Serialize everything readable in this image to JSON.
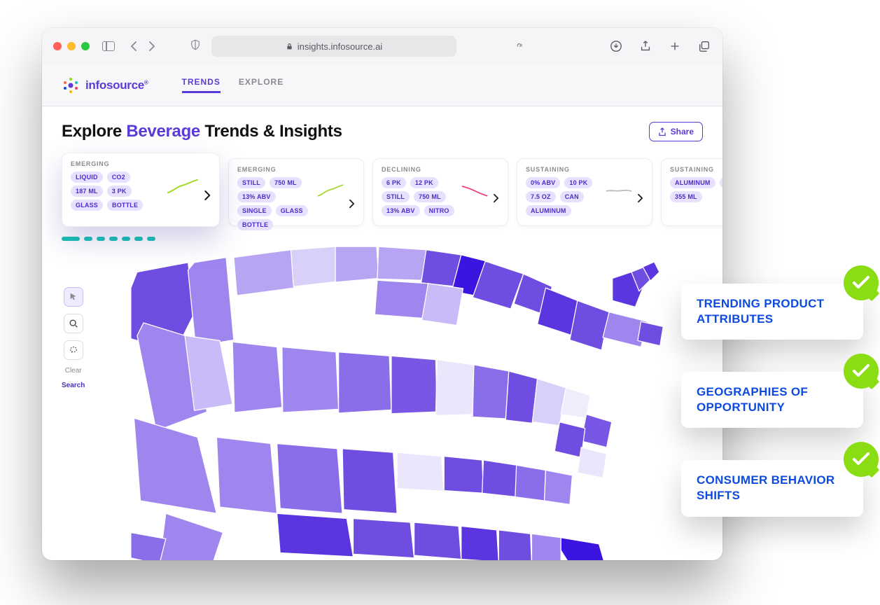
{
  "browser": {
    "url": "insights.infosource.ai"
  },
  "logo": {
    "text": "infosource"
  },
  "nav": {
    "tabs": [
      "TRENDS",
      "EXPLORE"
    ],
    "active": 0
  },
  "page": {
    "title_pre": "Explore ",
    "title_accent": "Beverage",
    "title_post": " Trends & Insights",
    "share_label": "Share"
  },
  "cards": [
    {
      "label": "EMERGING",
      "tags": [
        "LIQUID",
        "CO2",
        "187 ML",
        "3 PK",
        "GLASS",
        "BOTTLE"
      ],
      "spark_color": "#a7d82b",
      "size": "big"
    },
    {
      "label": "EMERGING",
      "tags": [
        "STILL",
        "750 ML",
        "13% ABV",
        "SINGLE",
        "GLASS",
        "BOTTLE"
      ],
      "spark_color": "#a7d82b"
    },
    {
      "label": "DECLINING",
      "tags": [
        "6 PK",
        "12 PK",
        "STILL",
        "750 ML",
        "13% ABV",
        "NITRO"
      ],
      "spark_color": "#ef3a6b"
    },
    {
      "label": "SUSTAINING",
      "tags": [
        "0% ABV",
        "10 PK",
        "7.5 OZ",
        "CAN",
        "ALUMINUM"
      ],
      "spark_color": "#b8b8be"
    },
    {
      "label": "SUSTAINING",
      "tags": [
        "ALUMINUM",
        "CAN",
        "355 ML"
      ],
      "spark_color": "#b8b8be",
      "partial": true
    }
  ],
  "map_tools": {
    "clear": "Clear",
    "search": "Search"
  },
  "callouts": [
    "TRENDING PRODUCT ATTRIBUTES",
    "GEOGRAPHIES OF OPPORTUNITY",
    "CONSUMER BEHAVIOR SHIFTS"
  ]
}
